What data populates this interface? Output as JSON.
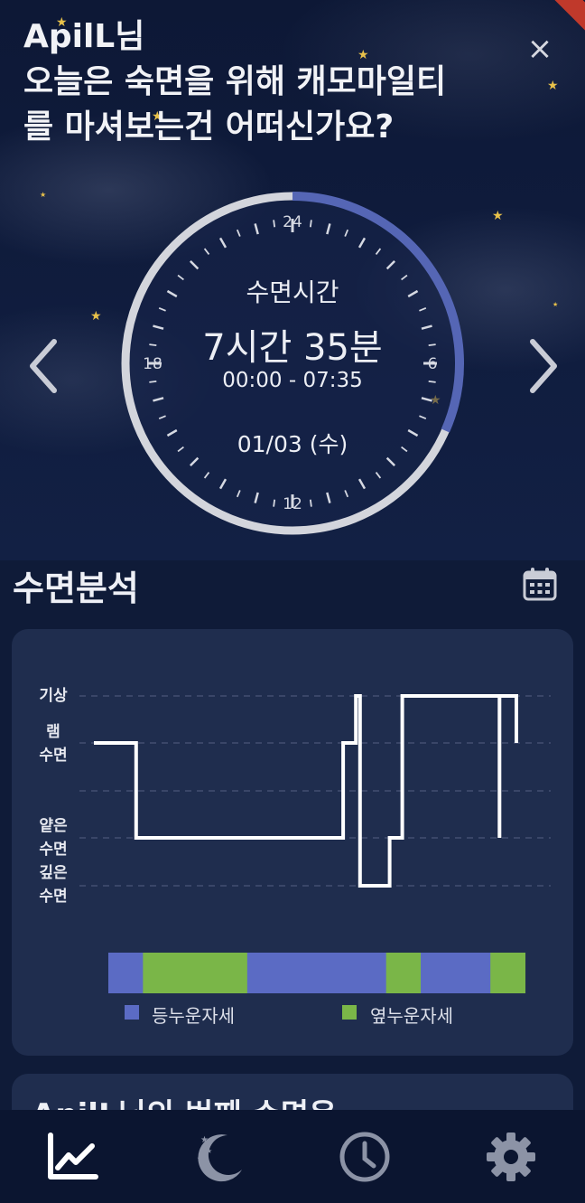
{
  "header": {
    "greeting_line1": "ApilL님",
    "greeting_line2": "오늘은 숙면을 위해 캐모마일티",
    "greeting_line3": "를 마셔보는건 어떠신가요?"
  },
  "clock": {
    "label": "수면시간",
    "duration": "7시간 35분",
    "range": "00:00 - 07:35",
    "date": "01/03 (수)",
    "hour_labels": {
      "top": "24",
      "right": "6",
      "bottom": "12",
      "left": "18"
    },
    "sleep_fraction_of_day": 0.316,
    "arc_color": "#5566b5",
    "ring_color": "#d3d5dc"
  },
  "analysis": {
    "title": "수면분석",
    "y_labels": {
      "wake": "기상",
      "rem_1": "램",
      "rem_2": "수면",
      "light_1": "얕은",
      "light_2": "수면",
      "deep_1": "깊은",
      "deep_2": "수면"
    },
    "legend": {
      "back": "등누운자세",
      "side": "옆누운자세"
    },
    "colors": {
      "back": "#5b6bc4",
      "side": "#7ab648"
    }
  },
  "chart_data": {
    "type": "line",
    "title": "",
    "levels": [
      "기상",
      "램 수면",
      "",
      "얕은 수면",
      "깊은 수면"
    ],
    "stage_steps": [
      {
        "t": 0.0,
        "level": 1
      },
      {
        "t": 0.1,
        "level": 1
      },
      {
        "t": 0.1,
        "level": 3
      },
      {
        "t": 0.59,
        "level": 3
      },
      {
        "t": 0.59,
        "level": 1
      },
      {
        "t": 0.62,
        "level": 1
      },
      {
        "t": 0.62,
        "level": 0
      },
      {
        "t": 0.63,
        "level": 0
      },
      {
        "t": 0.63,
        "level": 4
      },
      {
        "t": 0.7,
        "level": 4
      },
      {
        "t": 0.7,
        "level": 3
      },
      {
        "t": 0.73,
        "level": 3
      },
      {
        "t": 0.73,
        "level": 0
      },
      {
        "t": 0.96,
        "level": 0
      },
      {
        "t": 0.96,
        "level": 3
      },
      {
        "t": 0.96,
        "level": 0
      },
      {
        "t": 1.0,
        "level": 0
      },
      {
        "t": 1.0,
        "level": 1
      }
    ],
    "posture_segments": [
      {
        "posture": "back",
        "fraction": 0.083
      },
      {
        "posture": "side",
        "fraction": 0.25
      },
      {
        "posture": "back",
        "fraction": 0.333
      },
      {
        "posture": "side",
        "fraction": 0.083
      },
      {
        "posture": "back",
        "fraction": 0.167
      },
      {
        "posture": "side",
        "fraction": 0.083
      }
    ]
  },
  "next_card": {
    "title": "ApilL님의 번째 수면은"
  },
  "bottom_nav": {
    "items": [
      "analysis",
      "sleep",
      "history",
      "settings"
    ]
  }
}
